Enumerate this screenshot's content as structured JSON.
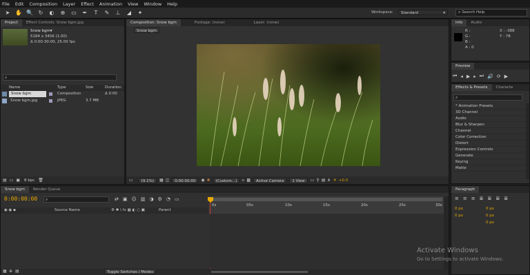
{
  "menu": [
    "File",
    "Edit",
    "Composition",
    "Layer",
    "Effect",
    "Animation",
    "View",
    "Window",
    "Help"
  ],
  "toolbar": {
    "workspace_label": "Workspace:",
    "workspace_value": "Standard",
    "search_placeholder": "Search Help"
  },
  "project": {
    "tabs": [
      "Project",
      "Effect Controls: Snow bgm.jpg"
    ],
    "comp_name": "Snow bgm▾",
    "comp_dims": "5184 x 3456 (1.00)",
    "comp_dur": "Δ 0:00:30:00, 25.00 fps",
    "columns": [
      "Name",
      "Type",
      "Size",
      "Duration"
    ],
    "rows": [
      {
        "name": "Snow bgm",
        "type": "Composition",
        "size": "",
        "duration": "Δ 0:00"
      },
      {
        "name": "Snow bgm.jpg",
        "type": "JPEG",
        "size": "3.7 MB",
        "duration": ""
      }
    ],
    "bpc": "8 bpc"
  },
  "comp": {
    "tabs": [
      "Composition: Snow bgm",
      "Footage: (none)",
      "Layer: (none)"
    ],
    "subtab": "Snow bgm",
    "bottom": {
      "zoom": "(9.1%)",
      "time": "0:00:00:00",
      "res": "(Custom...)",
      "camera": "Active Camera",
      "view": "1 View",
      "exposure": "+0.0"
    }
  },
  "info": {
    "tabs": [
      "Info",
      "Audio"
    ],
    "rgb": [
      "R :",
      "G :",
      "B :",
      "A : 0"
    ],
    "x": "X : -388",
    "y": "Y : 78"
  },
  "preview": {
    "tab": "Preview"
  },
  "effects": {
    "tabs": [
      "Effects & Presets",
      "Characte"
    ],
    "items": [
      "* Animation Presets",
      "3D Channel",
      "Audio",
      "Blur & Sharpen",
      "Channel",
      "Color Correction",
      "Distort",
      "Expression Controls",
      "Generate",
      "Keying",
      "Matte"
    ]
  },
  "timeline": {
    "tabs": [
      "Snow bgm",
      "Render Queue"
    ],
    "timecode": "0:00:00:00",
    "columns": {
      "source": "Source Name",
      "parent": "Parent"
    },
    "ruler": [
      "0s",
      "05s",
      "10s",
      "15s",
      "20s",
      "25s",
      "30s"
    ],
    "toggle": "Toggle Switches / Modes"
  },
  "paragraph": {
    "tab": "Paragraph",
    "px": [
      "0 px",
      "0 px",
      "0 px",
      "0 px",
      "0 px"
    ]
  },
  "watermark": {
    "line1": "Activate Windows",
    "line2": "Go to Settings to activate Windows."
  }
}
